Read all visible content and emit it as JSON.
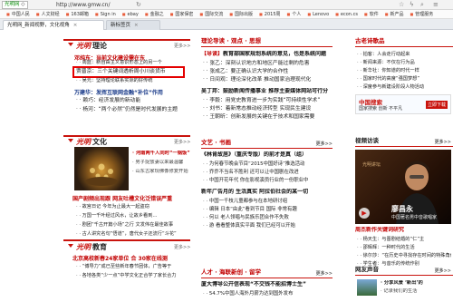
{
  "browser": {
    "address_pill": "光明网",
    "url": "http://www.gmw.cn/",
    "bookmarks": [
      "中国人民",
      "人文财经",
      "163邮箱",
      "Sign in",
      "ebay",
      "金融之",
      "国家保密",
      "国际交流",
      "国际出版",
      "2015周",
      "个人",
      "Lenovo",
      "econ.cs",
      "软件",
      "新产品",
      "管理服务"
    ],
    "tabs": [
      {
        "label": "光明网_新闻视野，文化视角"
      },
      {
        "label": "新标签页"
      }
    ]
  },
  "left": {
    "theory": {
      "title": "理论",
      "more": "更多>>",
      "headline1": "邓纯东：当前文化建设需在东",
      "headline1b": "加强理论研究不可本末倒置",
      "headline2": "贾晋京：三个关键词透析周小川谈货币",
      "headline3": "万建华：发挥互联网金融“补位”作用",
      "line2": "· 周蓝：新自由主义意识形态上的另一个",
      "line3": "· 吴元：坚持理论联系实际的好传统",
      "line4": "· 赖巧：经济发展的新动能",
      "line5": "· 杨河：“两个必然”仍然是时代发展的主题"
    },
    "culture": {
      "title": "文化",
      "more": "更多>>",
      "image_caption": "河南两千人同时“一锅饭”",
      "image_sub": "男子捉放妻以来最温馨",
      "image_sub2": "山东古家现佛像修复开始",
      "headline": "国产剧频出现跟 网友吐槽文化泛错误严重",
      "lines": [
        "· 故宫日记 今年为止最大一起盗窃",
        "· 万国一千叶经过风水，让故乡看到…",
        "· 剧团“千古开篇小场”之行 文发伟在最佳故事",
        "· 古人讲究名句“悟道”，唐代女子还流行“斗花”"
      ]
    },
    "education": {
      "title": "教育",
      "more": "更多>>",
      "headline": "北京高校新春24家单位 合 30家在线测",
      "lines": [
        "· “博导力”成已至些新年春节团体，广告等于",
        "· 各地各类“少一点”中学文化正合学了家长合力"
      ]
    }
  },
  "middle": {
    "theory_view": {
      "title": "理论导读 · 观点 · 思想",
      "tag": "【导读】",
      "headline": "教育部国家规划系统的意见，也是系统问题",
      "lines": [
        "· 张乙：深刻认识地方和地区产能过剩的危害",
        "· 张成乙：要正确认识大学的合作性",
        "· 日间观：理论深化改革 推动国家治理现代化"
      ],
      "bold": "吴丁邦：鼓励新闻传播事业 推荐主要媒体网站可行分",
      "lines2": [
        "· 李毅：用党史教育进一步为实践“可持续性学术”",
        "· 刘书：着新常态推动经济转型 实现民生建设",
        "· 王朝昕：创新发展的关键在于技术和国家需要"
      ]
    },
    "culture_review": {
      "title": "文艺 · 书画",
      "more": "更多>>",
      "headline": "《林肯故居》（重庆专版）的前才是真（组）",
      "lines": [
        "· 为何春节晚会节目“2015中国好诗”推选活动",
        "· 乔乔不当名不胜利 还可以让中国剧在改进",
        "· 中国开花年代 你在影视演员行业的一份职业中"
      ],
      "bold": "新年广告月的 生活真实 阿拉伯社会的某一切",
      "lines2": [
        "· 中国一千枝儿童都参与在本地研讨组",
        "· 编辑 日本“由此”看到节目 国际 非常有趣",
        "· 何以 老人领唱与民族乐团合作不失败",
        "· 游 看看整体真实平面 我们已经可以开始"
      ]
    },
    "people": {
      "title": "人才 · 海联新创 · 留学",
      "more": "更多>>",
      "headline": "厦大博导公开信表现“不交钱不能招博士生”",
      "line": "· 54.7%中国人海外月薪为达到国外发布"
    }
  },
  "right": {
    "classics": {
      "title": "古老诗歌品",
      "lines": [
        "· 拍客：人会走行动起来",
        "· 新闻来源：不仅在行为品",
        "· 新华社：你知道的时代一样",
        "· 国家时代的高度“强国梦想”",
        "· 深度参与新建设阶段人物活动"
      ]
    },
    "video": {
      "title": "视频访谈",
      "more": "更多>>",
      "video_caption": "廖昌永",
      "video_sub": "中国著名男中音歌唱家",
      "headline": "周杰新作关键词研究",
      "lines": [
        "· 杨天生：与晋剧结婚的“仁”主",
        "· 邵辉辉：一种时代的生活",
        "· 徐尔莎：“在历史中寻找存在时间的特殊角色”",
        "· 学生者：与音乐的传统作别"
      ]
    },
    "forum": {
      "title": "网友声音",
      "more": "更多>>",
      "line1": "分享风景 ‘新出’的",
      "line2": "记录我们的生活"
    },
    "ad": {
      "brand": "中国搜索",
      "text": "国家搜索 创新 不平凡",
      "button": "立即下载"
    }
  },
  "colors": {
    "red": "#c9130d",
    "highlight_box": "#e40000"
  }
}
